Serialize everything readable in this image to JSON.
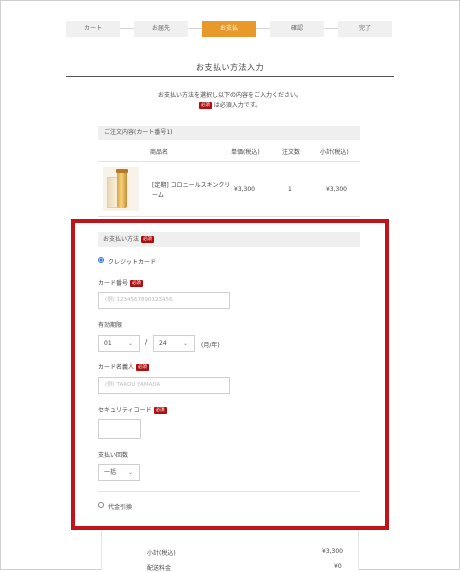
{
  "steps": [
    {
      "label": "カート"
    },
    {
      "label": "お届先"
    },
    {
      "label": "お支払"
    },
    {
      "label": "確認"
    },
    {
      "label": "完了"
    }
  ],
  "page": {
    "title": "お支払い方法入力",
    "intro_line1": "お支払い方法を選択し以下の内容をご入力ください。",
    "required_badge": "必須",
    "intro_line2_suffix": "は必須入力です。"
  },
  "order": {
    "heading": "ご注文内容(カート番号1)",
    "columns": {
      "product": "商品名",
      "unit_price": "単価(税込)",
      "qty": "注文数",
      "subtotal": "小計(税込)"
    },
    "items": [
      {
        "name": "[定期] コロニールスキンクリーム",
        "unit_price": "¥3,300",
        "qty": "1",
        "subtotal": "¥3,300"
      }
    ]
  },
  "payment": {
    "heading": "お支払い方法",
    "credit_label": "クレジットカード",
    "card_number_label": "カード番号",
    "card_number_placeholder": "(例) 1234567890123456",
    "expiry_label": "有効期限",
    "expiry_month": "01",
    "expiry_slash": "/",
    "expiry_year": "24",
    "expiry_suffix": "(月/年)",
    "holder_label": "カード名義人",
    "holder_placeholder": "(例) TAROU YAMADA",
    "security_label": "セキュリティコード",
    "installments_label": "支払い回数",
    "installments_value": "一括",
    "cod_label": "代金引換"
  },
  "summary": {
    "subtotal_label": "小計(税込)",
    "subtotal_value": "¥3,300",
    "shipping_label": "配送料金",
    "shipping_value": "¥0"
  },
  "colors": {
    "accent": "#e8992a",
    "highlight": "#c1141a",
    "required": "#b10d0d",
    "radio": "#2d6fd6"
  }
}
